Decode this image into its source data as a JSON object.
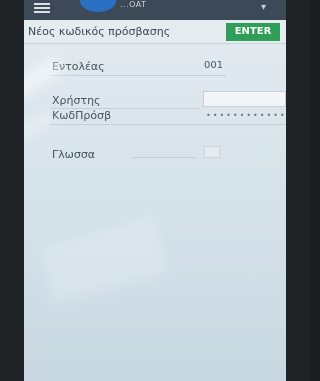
{
  "appbar": {
    "title_fragment": "...OAT",
    "menu_icon": "hamburger-icon",
    "overflow_icon": "more-vertical-icon"
  },
  "header": {
    "title": "Νέος κωδικός πρόσβασης",
    "enter_label": "ENTER",
    "enter_color": "#2f9e58"
  },
  "form": {
    "operator_label": "Εντολέας",
    "operator_value": "001",
    "user_label": "Χρήστης",
    "user_value": "",
    "password_label": "ΚωδΠρόσβ",
    "password_value": "••••••••••••",
    "language_label": "Γλωσσα"
  }
}
